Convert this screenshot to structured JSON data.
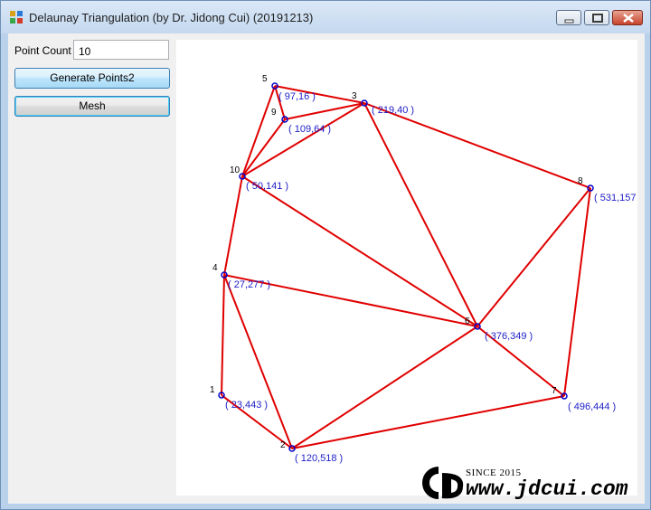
{
  "window": {
    "title": "Delaunay Triangulation (by Dr. Jidong Cui) (20191213)"
  },
  "controls": {
    "point_count_label": "Point Count",
    "point_count_value": "10",
    "generate_label": "Generate Points2",
    "mesh_label": "Mesh"
  },
  "plot": {
    "point_color": "#0000cc",
    "edge_color": "#e00000",
    "label_color": "#1c1cc8",
    "points": [
      {
        "id": "1",
        "coord": "( 23,443 )"
      },
      {
        "id": "2",
        "coord": "( 120,518 )"
      },
      {
        "id": "3",
        "coord": "( 219,40 )"
      },
      {
        "id": "4",
        "coord": "( 27,277 )"
      },
      {
        "id": "5",
        "coord": "( 97,16 )"
      },
      {
        "id": "6",
        "coord": "( 376,349 )"
      },
      {
        "id": "7",
        "coord": "( 496,444 )"
      },
      {
        "id": "8",
        "coord": "( 531,157"
      },
      {
        "id": "9",
        "coord": "( 109,64 )"
      },
      {
        "id": "10",
        "coord": "( 50,141 )"
      }
    ],
    "edges": [
      [
        "5",
        "3"
      ],
      [
        "5",
        "9"
      ],
      [
        "5",
        "10"
      ],
      [
        "9",
        "3"
      ],
      [
        "9",
        "10"
      ],
      [
        "10",
        "3"
      ],
      [
        "3",
        "8"
      ],
      [
        "3",
        "6"
      ],
      [
        "10",
        "6"
      ],
      [
        "10",
        "4"
      ],
      [
        "4",
        "6"
      ],
      [
        "4",
        "1"
      ],
      [
        "4",
        "2"
      ],
      [
        "1",
        "2"
      ],
      [
        "2",
        "6"
      ],
      [
        "2",
        "7"
      ],
      [
        "6",
        "7"
      ],
      [
        "6",
        "8"
      ],
      [
        "8",
        "7"
      ]
    ]
  },
  "watermark": {
    "since": "SINCE 2015",
    "url": "www.jdcui.com"
  }
}
